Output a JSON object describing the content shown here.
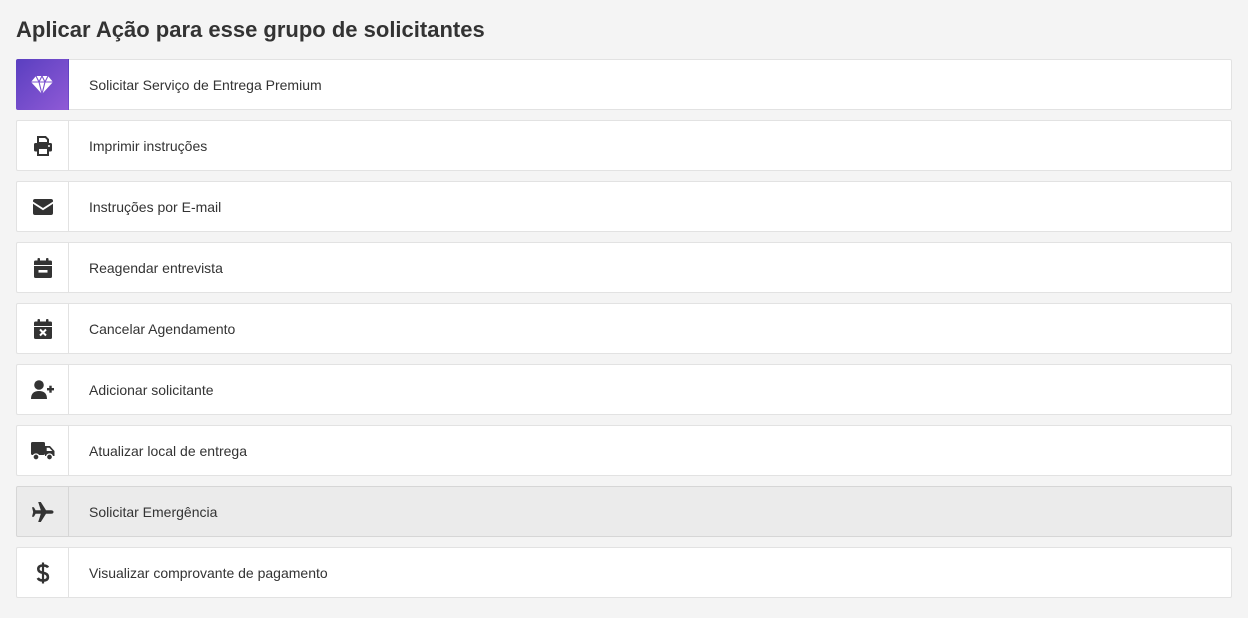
{
  "page": {
    "title": "Aplicar Ação para esse grupo de solicitantes"
  },
  "actions": [
    {
      "label": "Solicitar Serviço de Entrega Premium",
      "icon": "diamond-icon"
    },
    {
      "label": "Imprimir instruções",
      "icon": "printer-icon"
    },
    {
      "label": "Instruções por E-mail",
      "icon": "envelope-icon"
    },
    {
      "label": "Reagendar entrevista",
      "icon": "calendar-minus-icon"
    },
    {
      "label": "Cancelar Agendamento",
      "icon": "calendar-times-icon"
    },
    {
      "label": "Adicionar solicitante",
      "icon": "user-plus-icon"
    },
    {
      "label": "Atualizar local de entrega",
      "icon": "truck-icon"
    },
    {
      "label": "Solicitar Emergência",
      "icon": "plane-icon",
      "highlighted": true
    },
    {
      "label": "Visualizar comprovante de pagamento",
      "icon": "dollar-icon"
    }
  ],
  "colors": {
    "premium_gradient_start": "#5a3fc0",
    "premium_gradient_end": "#8f5ad6",
    "icon": "#333333",
    "highlight_background": "#ebebeb",
    "page_background": "#f4f4f4"
  }
}
